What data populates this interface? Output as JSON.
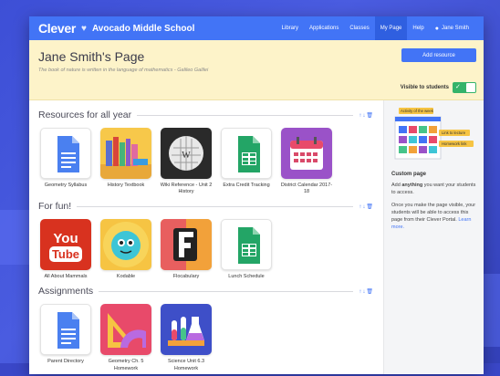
{
  "nav": {
    "brand": "Clever",
    "school": "Avocado Middle School",
    "links": [
      "Library",
      "Applications",
      "Classes",
      "My Page",
      "Help"
    ],
    "active": "My Page",
    "user": "Jane Smith"
  },
  "header": {
    "title": "Jane Smith's Page",
    "quote": "The book of nature is written in the language of mathematics - Galileo Galilei",
    "add_button": "Add resource",
    "visible_label": "Visible to students",
    "visible": true
  },
  "sections": [
    {
      "title": "Resources for all year",
      "items": [
        {
          "label": "Geometry Syllabus",
          "icon": "google-docs-icon"
        },
        {
          "label": "History Textbook",
          "icon": "books-icon"
        },
        {
          "label": "Wiki Reference - Unit 2 History",
          "icon": "wikipedia-icon"
        },
        {
          "label": "Extra Credit Tracking",
          "icon": "google-sheets-icon"
        },
        {
          "label": "District Calendar 2017-18",
          "icon": "calendar-icon"
        }
      ]
    },
    {
      "title": "For fun!",
      "items": [
        {
          "label": "All About Mammals",
          "icon": "youtube-icon"
        },
        {
          "label": "Kodable",
          "icon": "kodable-icon"
        },
        {
          "label": "Flocabulary",
          "icon": "flocabulary-icon"
        },
        {
          "label": "Lunch Schedule",
          "icon": "google-sheets-icon"
        }
      ]
    },
    {
      "title": "Assignments",
      "items": [
        {
          "label": "Parent Directory",
          "icon": "google-docs-icon"
        },
        {
          "label": "Geometry Ch. 5 Homework",
          "icon": "geometry-icon"
        },
        {
          "label": "Science Unit 6.3 Homework",
          "icon": "science-icon"
        }
      ]
    }
  ],
  "side": {
    "illus_tags": [
      "Activity of the week",
      "Link to lecture",
      "Homework link"
    ],
    "title": "Custom page",
    "p1_pre": "Add ",
    "p1_bold": "anything",
    "p1_post": " you want your students to access.",
    "p2": "Once you make the page visible, your students will be able to access this page from their Clever Portal.",
    "learn_more": "Learn more."
  },
  "colors": {
    "brand": "#4274f6",
    "header_bg": "#fdf3c9",
    "toggle_on": "#34b36a"
  }
}
